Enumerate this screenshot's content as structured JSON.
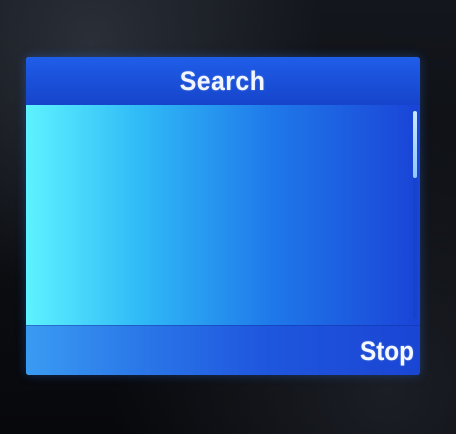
{
  "screen": {
    "title": "Search",
    "content_items": [],
    "scrollbar": {
      "visible": true,
      "position_fraction": 0.0,
      "thumb_fraction": 0.32
    }
  },
  "softkeys": {
    "left_label": "",
    "right_label": "Stop"
  },
  "colors": {
    "title_bar": "#1a4fd8",
    "content_gradient_left": "#5df2ff",
    "content_gradient_right": "#1a43d7",
    "text": "#f2f7ff",
    "bezel": "#0b0d12"
  },
  "icons": {
    "scrollbar": "vertical-scrollbar"
  }
}
